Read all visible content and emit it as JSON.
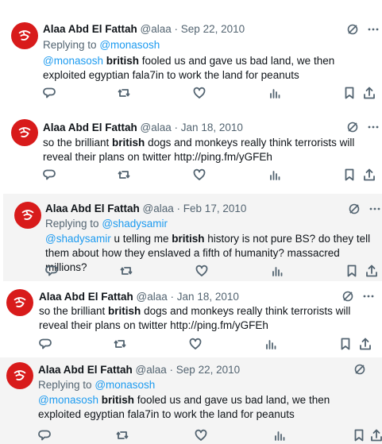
{
  "tweets": [
    {
      "name": "Alaa Abd El Fattah",
      "handle": "@alaa",
      "dot": "·",
      "date": "Sep 22, 2010",
      "replying_prefix": "Replying to",
      "replying_to": "@monasosh",
      "mention": "@monasosh",
      "text_before": " ",
      "bold": "british",
      "text_after": " fooled us and gave us bad land, we then exploited egyptian fala7in to work the land for peanuts"
    },
    {
      "name": "Alaa Abd El Fattah",
      "handle": "@alaa",
      "dot": "·",
      "date": "Jan 18, 2010",
      "text_before": "so the brilliant ",
      "bold": "british",
      "text_after": " dogs and monkeys really think terrorists will reveal their plans on twitter http://ping.fm/yGFEh"
    },
    {
      "name": "Alaa Abd El Fattah",
      "handle": "@alaa",
      "dot": "·",
      "date": "Feb 17, 2010",
      "replying_prefix": "Replying to",
      "replying_to": "@shadysamir",
      "mention": "@shadysamir",
      "text_before": " u telling me ",
      "bold": "british",
      "text_after": " history is not pure BS? do they tell them about how they enslaved a fifth of humanity? massacred millions?"
    },
    {
      "name": "Alaa Abd El Fattah",
      "handle": "@alaa",
      "dot": "·",
      "date": "Jan 18, 2010",
      "text_before": "so the brilliant ",
      "bold": "british",
      "text_after": " dogs and monkeys really think terrorists will reveal their plans on twitter http://ping.fm/yGFEh"
    },
    {
      "name": "Alaa Abd El Fattah",
      "handle": "@alaa",
      "dot": "·",
      "date": "Sep 22, 2010",
      "replying_prefix": "Replying to",
      "replying_to": "@monasosh",
      "mention": "@monasosh",
      "text_before": " ",
      "bold": "british",
      "text_after": " fooled us and gave us bad land, we then exploited egyptian fala7in to work the land for peanuts"
    }
  ],
  "icons": {
    "more": "more-options-icon",
    "grok": "grok-icon",
    "reply": "reply-icon",
    "retweet": "retweet-icon",
    "like": "like-icon",
    "views": "views-icon",
    "bookmark": "bookmark-icon",
    "share": "share-icon"
  },
  "colors": {
    "avatar": "#d81b1b",
    "link": "#1d9bf0",
    "muted": "#536471"
  }
}
